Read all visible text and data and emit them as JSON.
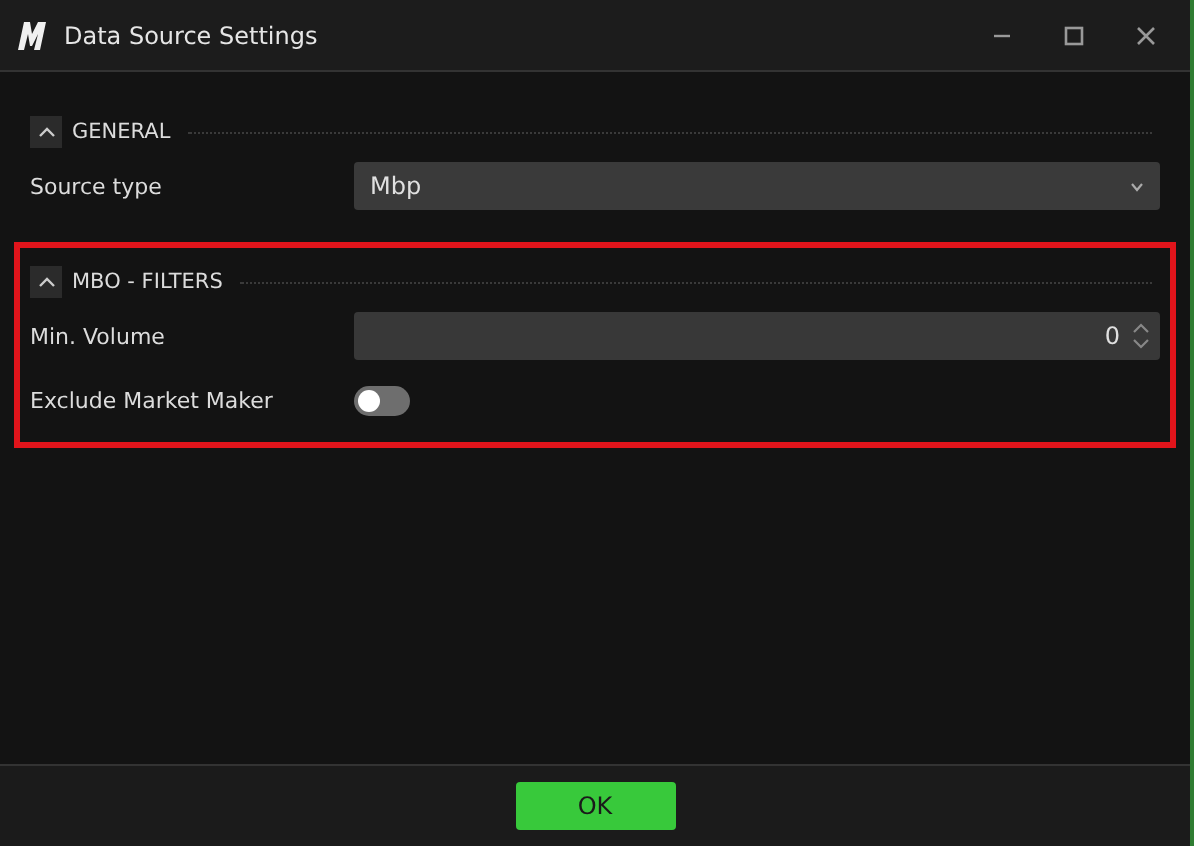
{
  "window": {
    "title": "Data Source Settings"
  },
  "sections": [
    {
      "title": "GENERAL",
      "expanded": true,
      "highlighted": false,
      "rows": [
        {
          "kind": "dropdown",
          "label": "Source type",
          "value": "Mbp"
        }
      ]
    },
    {
      "title": "MBO - FILTERS",
      "expanded": true,
      "highlighted": true,
      "rows": [
        {
          "kind": "number",
          "label": "Min. Volume",
          "value": "0"
        },
        {
          "kind": "toggle",
          "label": "Exclude Market Maker",
          "on": false
        }
      ]
    }
  ],
  "buttons": [
    "OK"
  ]
}
